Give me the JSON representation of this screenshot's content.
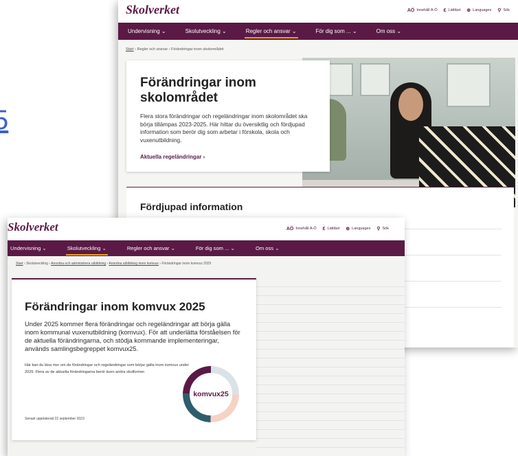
{
  "stray_link": {
    "text": "5"
  },
  "back": {
    "header": {
      "logo": "Skolverket",
      "utilities": [
        {
          "icon": "ab-icon",
          "glyph": "AÖ",
          "label": "Innehåll A-Ö"
        },
        {
          "icon": "easy-read-icon",
          "glyph": "₤",
          "label": "Lättläst"
        },
        {
          "icon": "globe-icon",
          "glyph": "⊕",
          "label": "Languages"
        },
        {
          "icon": "search-icon",
          "glyph": "⚲",
          "label": "Sök"
        }
      ]
    },
    "nav": [
      {
        "label": "Undervisning ⌄"
      },
      {
        "label": "Skolutveckling ⌄"
      },
      {
        "label": "Regler och ansvar ⌄"
      },
      {
        "label": "För dig som ... ⌄"
      },
      {
        "label": "Om oss ⌄"
      }
    ],
    "breadcrumb": {
      "home": "Start",
      "rest": " › Regler och ansvar › Förändringar inom skolområdet"
    },
    "card": {
      "title": "Förändringar inom skolområdet",
      "body": "Flera stora förändringar och regeländringar inom skolområdet ska börja tillämpas 2023-2025. Här hittar du översiktlig och fördjupad information som berör dig som arbetar i förskola, skola och vuxenutbildning.",
      "link": "Aktuella regeländringar ›"
    },
    "section": {
      "title": "Fördjupad information"
    }
  },
  "front": {
    "header": {
      "logo": "Skolverket",
      "utilities": [
        {
          "icon": "ab-icon",
          "glyph": "AÖ",
          "label": "Innehåll A-Ö"
        },
        {
          "icon": "easy-read-icon",
          "glyph": "₤",
          "label": "Lättläst"
        },
        {
          "icon": "globe-icon",
          "glyph": "⊕",
          "label": "Languages"
        },
        {
          "icon": "search-icon",
          "glyph": "⚲",
          "label": "Sök"
        }
      ]
    },
    "nav": [
      {
        "label": "Undervisning ⌄"
      },
      {
        "label": "Skolutveckling ⌄"
      },
      {
        "label": "Regler och ansvar ⌄"
      },
      {
        "label": "För dig som ... ⌄"
      },
      {
        "label": "Om oss ⌄"
      }
    ],
    "breadcrumb": {
      "items": [
        "Start",
        " › Skolutveckling › ",
        "Anordna och administrera utbildning",
        " › ",
        "Anordna utbildning inom komvux",
        " › Förändringar inom komvux 2025"
      ]
    },
    "card": {
      "title": "Förändringar inom komvux 2025",
      "lead": "Under 2025 kommer flera förändringar och regeländringar att börja gälla inom kommunal vuxenutbildning (komvux). För att underlätta förståelsen för de aktuella förändringarna, och stödja kommande implementeringar, används samlingsbegreppet komvux25.",
      "small": "Här kan du läsa mer om de förändringar och regeländringar som börjar gälla inom komvux under 2025. Flera av de aktuella förändringarna berör även andra skolformer.",
      "updated": "Senast uppdaterad 22 september 2023",
      "badge": "komvux25"
    }
  },
  "colors": {
    "brand": "#5a1a45",
    "accent": "#f09b1f",
    "donut": [
      "#d9e2e8",
      "#f6d2c4",
      "#2e5d6c",
      "#5a1a45"
    ]
  }
}
